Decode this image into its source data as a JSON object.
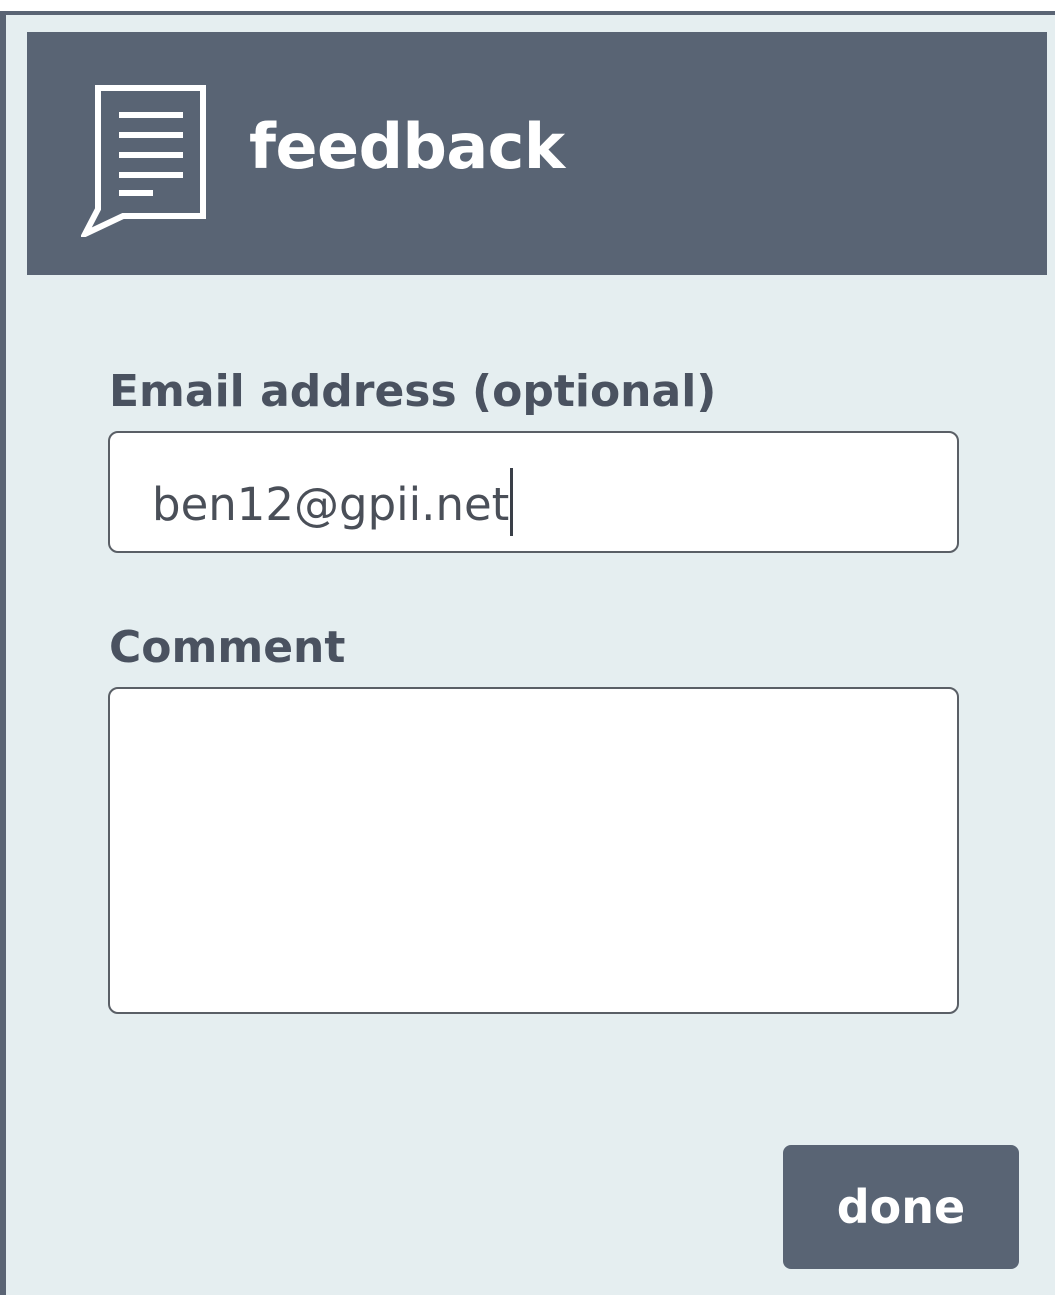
{
  "header": {
    "title": "feedback",
    "icon": "feedback-document-icon"
  },
  "form": {
    "email": {
      "label": "Email address (optional)",
      "value": "ben12@gpii.net"
    },
    "comment": {
      "label": "Comment",
      "value": ""
    },
    "done_label": "done"
  },
  "colors": {
    "header_bg": "#596474",
    "panel_bg": "#e5eef0",
    "label_text": "#4a5260",
    "button_bg": "#596474"
  }
}
